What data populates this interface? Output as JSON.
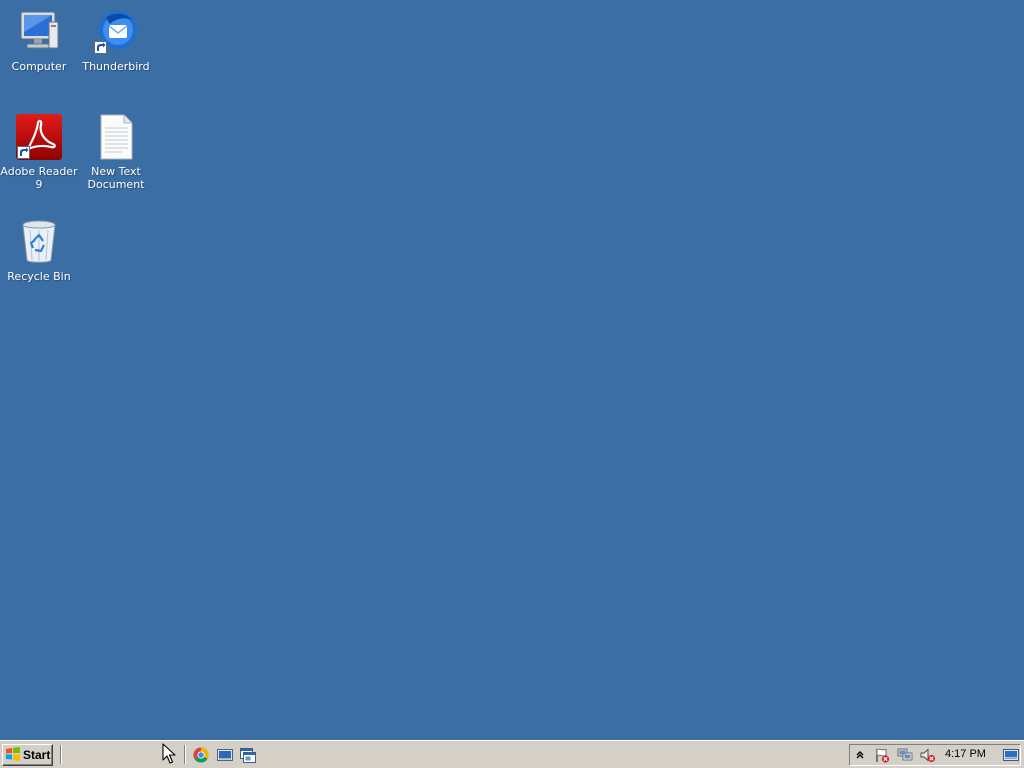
{
  "desktop": {
    "background_color": "#3a6ea5",
    "icons": [
      {
        "label": "Computer",
        "icon": "computer-icon",
        "shortcut": false
      },
      {
        "label": "Thunderbird",
        "icon": "thunderbird-icon",
        "shortcut": true
      },
      {
        "label": "Adobe Reader 9",
        "icon": "adobe-reader-icon",
        "shortcut": true
      },
      {
        "label": "New Text Document",
        "icon": "text-document-icon",
        "shortcut": false
      },
      {
        "label": "Recycle Bin",
        "icon": "recycle-bin-icon",
        "shortcut": false
      }
    ]
  },
  "taskbar": {
    "start_label": "Start",
    "quick_launch": [
      {
        "icon": "chrome-icon"
      },
      {
        "icon": "show-desktop-icon"
      },
      {
        "icon": "window-switch-icon"
      }
    ],
    "tray": {
      "icons": [
        "show-hidden-icons-chevron",
        "action-center-flag-icon",
        "network-icon",
        "volume-muted-icon"
      ],
      "clock": "4:17 PM",
      "show_desktop": "show-desktop-button"
    }
  }
}
